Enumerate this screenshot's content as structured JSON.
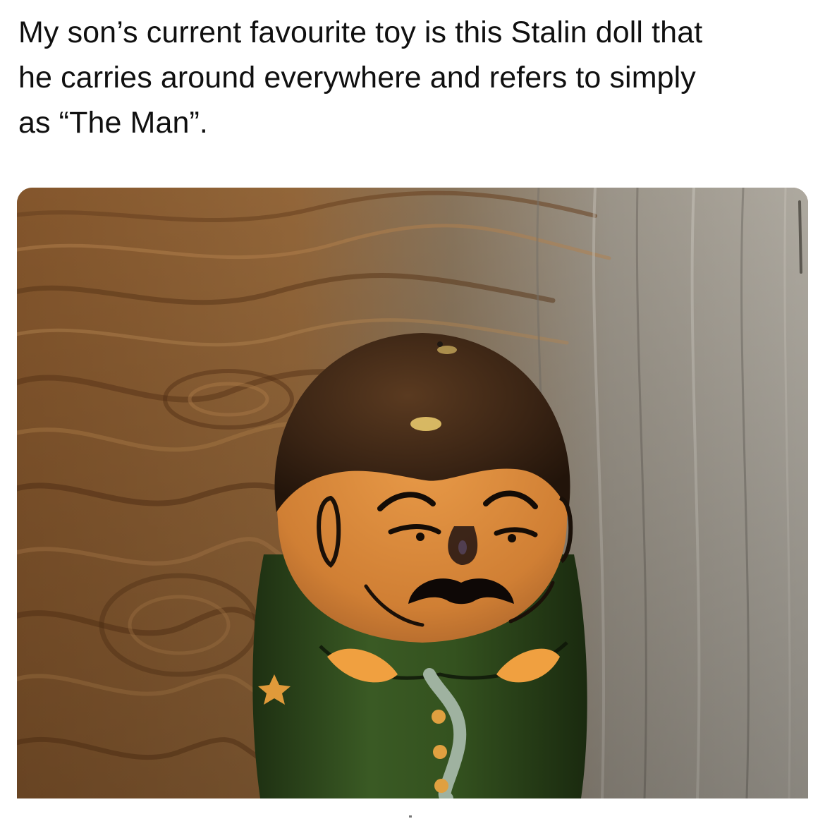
{
  "post": {
    "caption_lines": [
      "My son’s current favourite toy is this Stalin doll that",
      "he carries around everywhere and refers to simply",
      "as “The Man”."
    ]
  },
  "photo": {
    "subject": "painted wooden Stalin doll on a wooden table",
    "colors": {
      "wood_warm": "#9a6a3a",
      "wood_grey": "#a8a39a",
      "hair": "#3a2414",
      "face": "#d98a3a",
      "uniform": "#2f4a1e",
      "epaulette": "#f0a040"
    }
  }
}
